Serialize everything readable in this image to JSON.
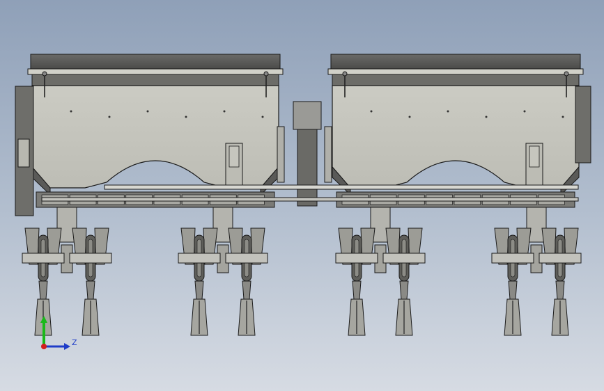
{
  "viewport": {
    "background_top": "#8fa0b8",
    "background_bottom": "#d6dbe3"
  },
  "model": {
    "body_color": "#c8c8c0",
    "frame_color": "#5a5a58",
    "steel_color": "#8a8a88",
    "edge_color": "#1a1a1a",
    "row_units": 8
  },
  "triad": {
    "z_label": "Z",
    "y_axis_color": "#19b919",
    "z_axis_color": "#1e3cc8",
    "origin_color": "#d21e1e"
  }
}
